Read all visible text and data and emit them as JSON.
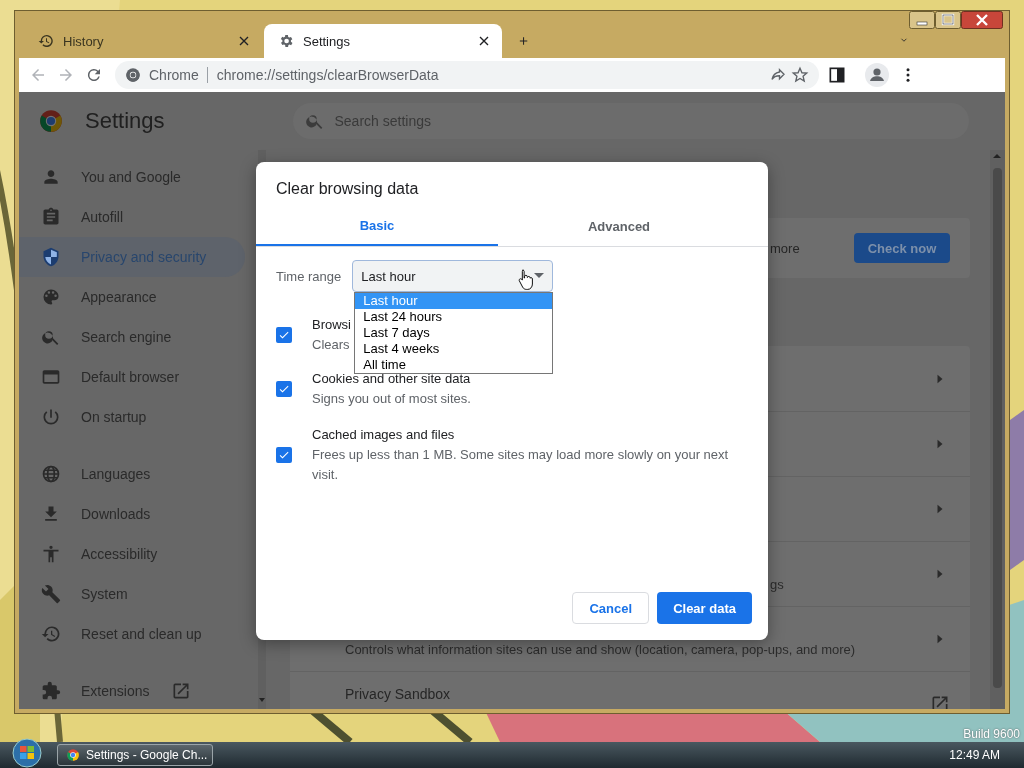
{
  "browser": {
    "tabs": [
      {
        "title": "History",
        "selected": false
      },
      {
        "title": "Settings",
        "selected": true
      }
    ],
    "omnibox": {
      "chip": "Chrome",
      "url": "chrome://settings/clearBrowserData"
    }
  },
  "settings": {
    "title": "Settings",
    "search": {
      "placeholder": "Search settings"
    },
    "sidebar": {
      "sections": [
        {
          "items": [
            {
              "label": "You and Google",
              "kind": "page",
              "selected": false
            },
            {
              "label": "Autofill",
              "kind": "page",
              "selected": false
            },
            {
              "label": "Privacy and security",
              "kind": "page",
              "selected": true
            },
            {
              "label": "Appearance",
              "kind": "page",
              "selected": false
            },
            {
              "label": "Search engine",
              "kind": "page",
              "selected": false
            },
            {
              "label": "Default browser",
              "kind": "page",
              "selected": false
            },
            {
              "label": "On startup",
              "kind": "page",
              "selected": false
            }
          ]
        },
        {
          "items": [
            {
              "label": "Languages",
              "kind": "page",
              "selected": false
            },
            {
              "label": "Downloads",
              "kind": "page",
              "selected": false
            },
            {
              "label": "Accessibility",
              "kind": "page",
              "selected": false
            },
            {
              "label": "System",
              "kind": "page",
              "selected": false
            },
            {
              "label": "Reset and clean up",
              "kind": "page",
              "selected": false
            }
          ]
        },
        {
          "items": [
            {
              "label": "Extensions",
              "kind": "external",
              "selected": false
            }
          ]
        }
      ]
    },
    "safety_check": {
      "text": "more",
      "button": "Check now"
    },
    "privacy_rows": [
      {
        "kind": "arrow"
      },
      {
        "kind": "arrow"
      },
      {
        "kind": "arrow"
      },
      {
        "kind": "arrow",
        "subtitle": "gs"
      },
      {
        "kind": "arrow",
        "subtitle": "Controls what information sites can use and show (location, camera, pop-ups, and more)"
      },
      {
        "kind": "external",
        "title": "Privacy Sandbox"
      }
    ]
  },
  "dialog": {
    "title": "Clear browsing data",
    "tabs": [
      {
        "label": "Basic",
        "selected": true
      },
      {
        "label": "Advanced",
        "selected": false
      }
    ],
    "time_range": {
      "label": "Time range",
      "value": "Last hour",
      "options": [
        {
          "label": "Last hour",
          "selected": true
        },
        {
          "label": "Last 24 hours",
          "selected": false
        },
        {
          "label": "Last 7 days",
          "selected": false
        },
        {
          "label": "Last 4 weeks",
          "selected": false
        },
        {
          "label": "All time",
          "selected": false
        }
      ]
    },
    "items": [
      {
        "title": "Browsi",
        "description": "Clears",
        "checked": true
      },
      {
        "title": "Cookies and other site data",
        "description": "Signs you out of most sites.",
        "checked": true
      },
      {
        "title": "Cached images and files",
        "description": "Frees up less than 1 MB. Some sites may load more slowly on your next visit.",
        "checked": true
      }
    ],
    "buttons": [
      {
        "label": "Cancel",
        "kind": "secondary"
      },
      {
        "label": "Clear data",
        "kind": "primary"
      }
    ]
  },
  "desktop": {
    "build": "Build 9600"
  },
  "taskbar": {
    "tasks": [
      {
        "label": "Settings - Google Ch...",
        "selected": true
      }
    ],
    "clock": "12:49 AM"
  }
}
